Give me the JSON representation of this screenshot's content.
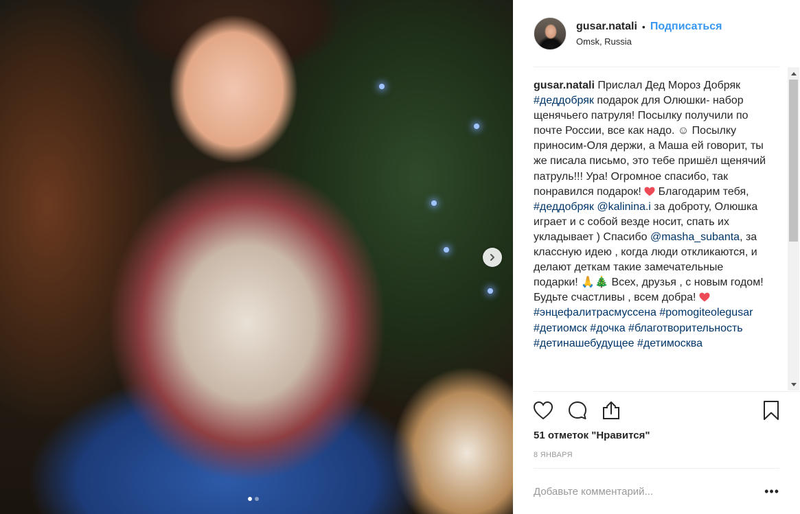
{
  "post": {
    "photo_alt": "",
    "carousel_dots": 2,
    "active_dot": 0
  },
  "header": {
    "username": "gusar.natali",
    "separator": "•",
    "follow_label": "Подписаться",
    "location": "Omsk, Russia"
  },
  "caption": {
    "username": "gusar.natali",
    "parts": [
      {
        "t": "text",
        "v": " Прислал Дед Мороз Добряк "
      },
      {
        "t": "tag",
        "v": "#деддобряк"
      },
      {
        "t": "text",
        "v": " подарок для Олюшки- набор щенячьего патруля! Посылку получили по почте России, все как надо. ☺ Посылку приносим-Оля держи, а Маша ей говорит, ты же писала письмо, это тебе пришёл щенячий патруль!!! Ура! Огромное спасибо, так понравился подарок! "
      },
      {
        "t": "heart",
        "v": "red-heart-emoji"
      },
      {
        "t": "text",
        "v": " Благодарим тебя, "
      },
      {
        "t": "tag",
        "v": "#деддобряк"
      },
      {
        "t": "text",
        "v": " "
      },
      {
        "t": "tag",
        "v": "@kalinina.i"
      },
      {
        "t": "text",
        "v": " за доброту, Олюшка играет и с собой везде носит, спать их укладывает ) Спасибо "
      },
      {
        "t": "tag",
        "v": "@masha_subanta"
      },
      {
        "t": "text",
        "v": ", за классную идею , когда люди откликаются, и делают деткам такие замечательные подарки! 🙏🎄 Всех, друзья , с новым годом! Будьте счастливы , всем добра! "
      },
      {
        "t": "heart",
        "v": "red-heart-emoji"
      },
      {
        "t": "text",
        "v": " "
      },
      {
        "t": "tag",
        "v": "#энцефалитрасмуссена"
      },
      {
        "t": "text",
        "v": " "
      },
      {
        "t": "tag",
        "v": "#pomogiteolegusar"
      },
      {
        "t": "text",
        "v": " "
      },
      {
        "t": "tag",
        "v": "#детиомск"
      },
      {
        "t": "text",
        "v": " "
      },
      {
        "t": "tag",
        "v": "#дочка"
      },
      {
        "t": "text",
        "v": " "
      },
      {
        "t": "tag",
        "v": "#благотворительность"
      },
      {
        "t": "text",
        "v": " "
      },
      {
        "t": "tag",
        "v": "#детинашебудущее"
      },
      {
        "t": "text",
        "v": " "
      },
      {
        "t": "tag",
        "v": "#детимосква"
      }
    ]
  },
  "actions": {
    "like_icon": "heart-outline-icon",
    "comment_icon": "comment-bubble-icon",
    "share_icon": "share-icon",
    "save_icon": "bookmark-icon"
  },
  "likes_text": "51 отметок \"Нравится\"",
  "date_text": "8 ЯНВАРЯ",
  "comment": {
    "placeholder": "Добавьте комментарий...",
    "more_label": "•••"
  },
  "colors": {
    "link_blue": "#3897f0",
    "tag_blue": "#003569",
    "text": "#262626",
    "muted": "#999999",
    "heart_red": "#ed4956"
  }
}
